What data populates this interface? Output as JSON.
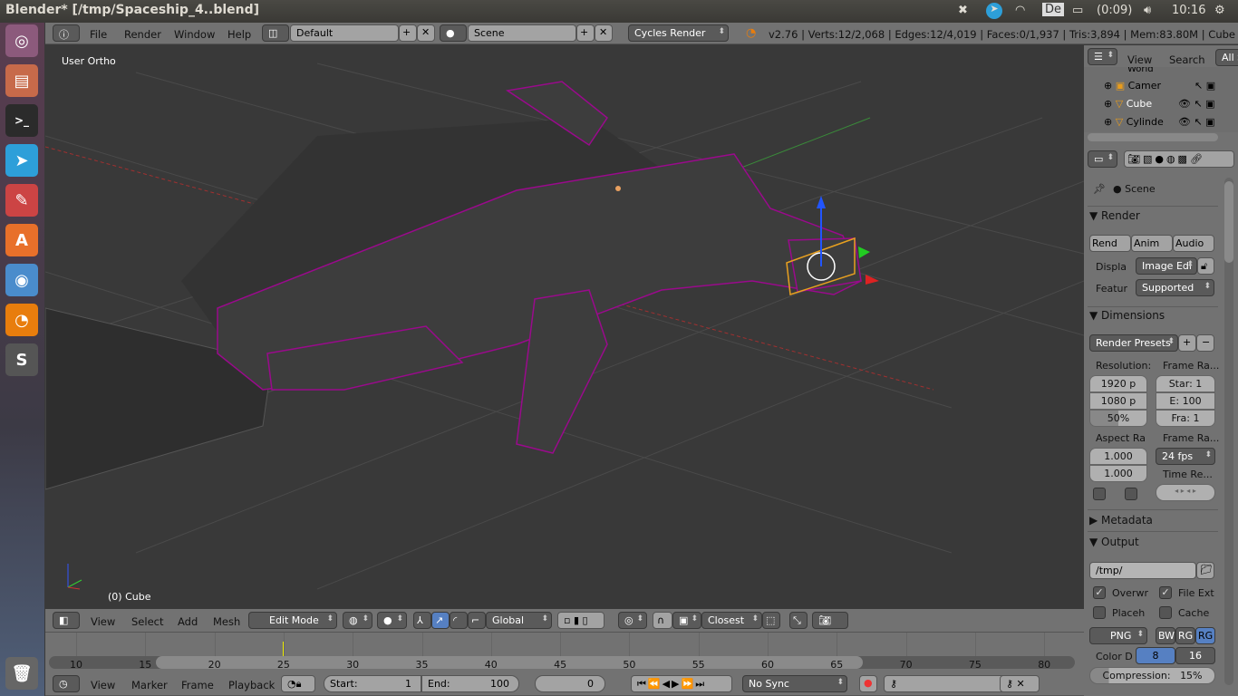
{
  "os": {
    "window_title": "Blender* [/tmp/Spaceship_4..blend]",
    "battery": "(0:09)",
    "keyboard": "De",
    "time": "10:16"
  },
  "launcher": [
    "ubuntu-icon",
    "files-icon",
    "terminal-icon",
    "telegram-icon",
    "settings-icon",
    "software-center-icon",
    "chromium-icon",
    "blender-icon",
    "sublime-icon",
    "trash-icon"
  ],
  "info_header": {
    "menus": [
      "File",
      "Render",
      "Window",
      "Help"
    ],
    "layout": "Default",
    "scene": "Scene",
    "engine": "Cycles Render",
    "stats": "v2.76 | Verts:12/2,068 | Edges:12/4,019 | Faces:0/1,937 | Tris:3,894 | Mem:83.80M | Cube"
  },
  "viewport": {
    "view_label": "User Ortho",
    "object_label": "(0) Cube",
    "wire_color": "#9a0a8c",
    "bg": "#393939"
  },
  "view3d_header": {
    "menus": [
      "View",
      "Select",
      "Add",
      "Mesh"
    ],
    "mode": "Edit Mode",
    "orientation": "Global",
    "snap": "Closest"
  },
  "timeline": {
    "ticks": [
      "10",
      "15",
      "20",
      "25",
      "30",
      "35",
      "40",
      "45",
      "50",
      "55",
      "60",
      "65",
      "70",
      "75",
      "80"
    ],
    "current_frame": 25,
    "menus": [
      "View",
      "Marker",
      "Frame",
      "Playback"
    ],
    "start_label": "Start:",
    "start": "1",
    "end_label": "End:",
    "end": "100",
    "frame": "0",
    "sync": "No Sync"
  },
  "outliner": {
    "menus": [
      "View",
      "Search"
    ],
    "filter": "All S",
    "items": [
      "World",
      "Camer",
      "Cube",
      "Cylinde"
    ]
  },
  "properties": {
    "context": "Scene",
    "render": {
      "title": "Render",
      "buttons": [
        "Rend",
        "Anim",
        "Audio"
      ],
      "display_label": "Displa",
      "display": "Image Edi",
      "feature_label": "Featur",
      "feature": "Supported"
    },
    "dimensions": {
      "title": "Dimensions",
      "presets": "Render Presets",
      "resolution_label": "Resolution:",
      "res_x": "1920 p",
      "res_y": "1080 p",
      "res_pct": "50%",
      "res_pct_value": 50,
      "frame_range_label": "Frame Ra...",
      "start": "Star: 1",
      "end": "E: 100",
      "step": "Fra:  1",
      "aspect_label": "Aspect Ra",
      "aspect_x": "1.000",
      "aspect_y": "1.000",
      "frame_rate_label": "Frame Ra...",
      "fps": "24 fps",
      "time_remap_label": "Time Re..."
    },
    "metadata": {
      "title": "Metadata"
    },
    "output": {
      "title": "Output",
      "path": "/tmp/",
      "overwrite": "Overwr",
      "file_ext": "File Ext",
      "placeholder": "Placeh",
      "cache": "Cache",
      "format": "PNG",
      "bw": "BW",
      "rgb": "RG",
      "rgba": "RG",
      "color_depth_label": "Color D",
      "depth8": "8",
      "depth16": "16",
      "compression": "Compression:",
      "compression_value": "15%"
    }
  }
}
